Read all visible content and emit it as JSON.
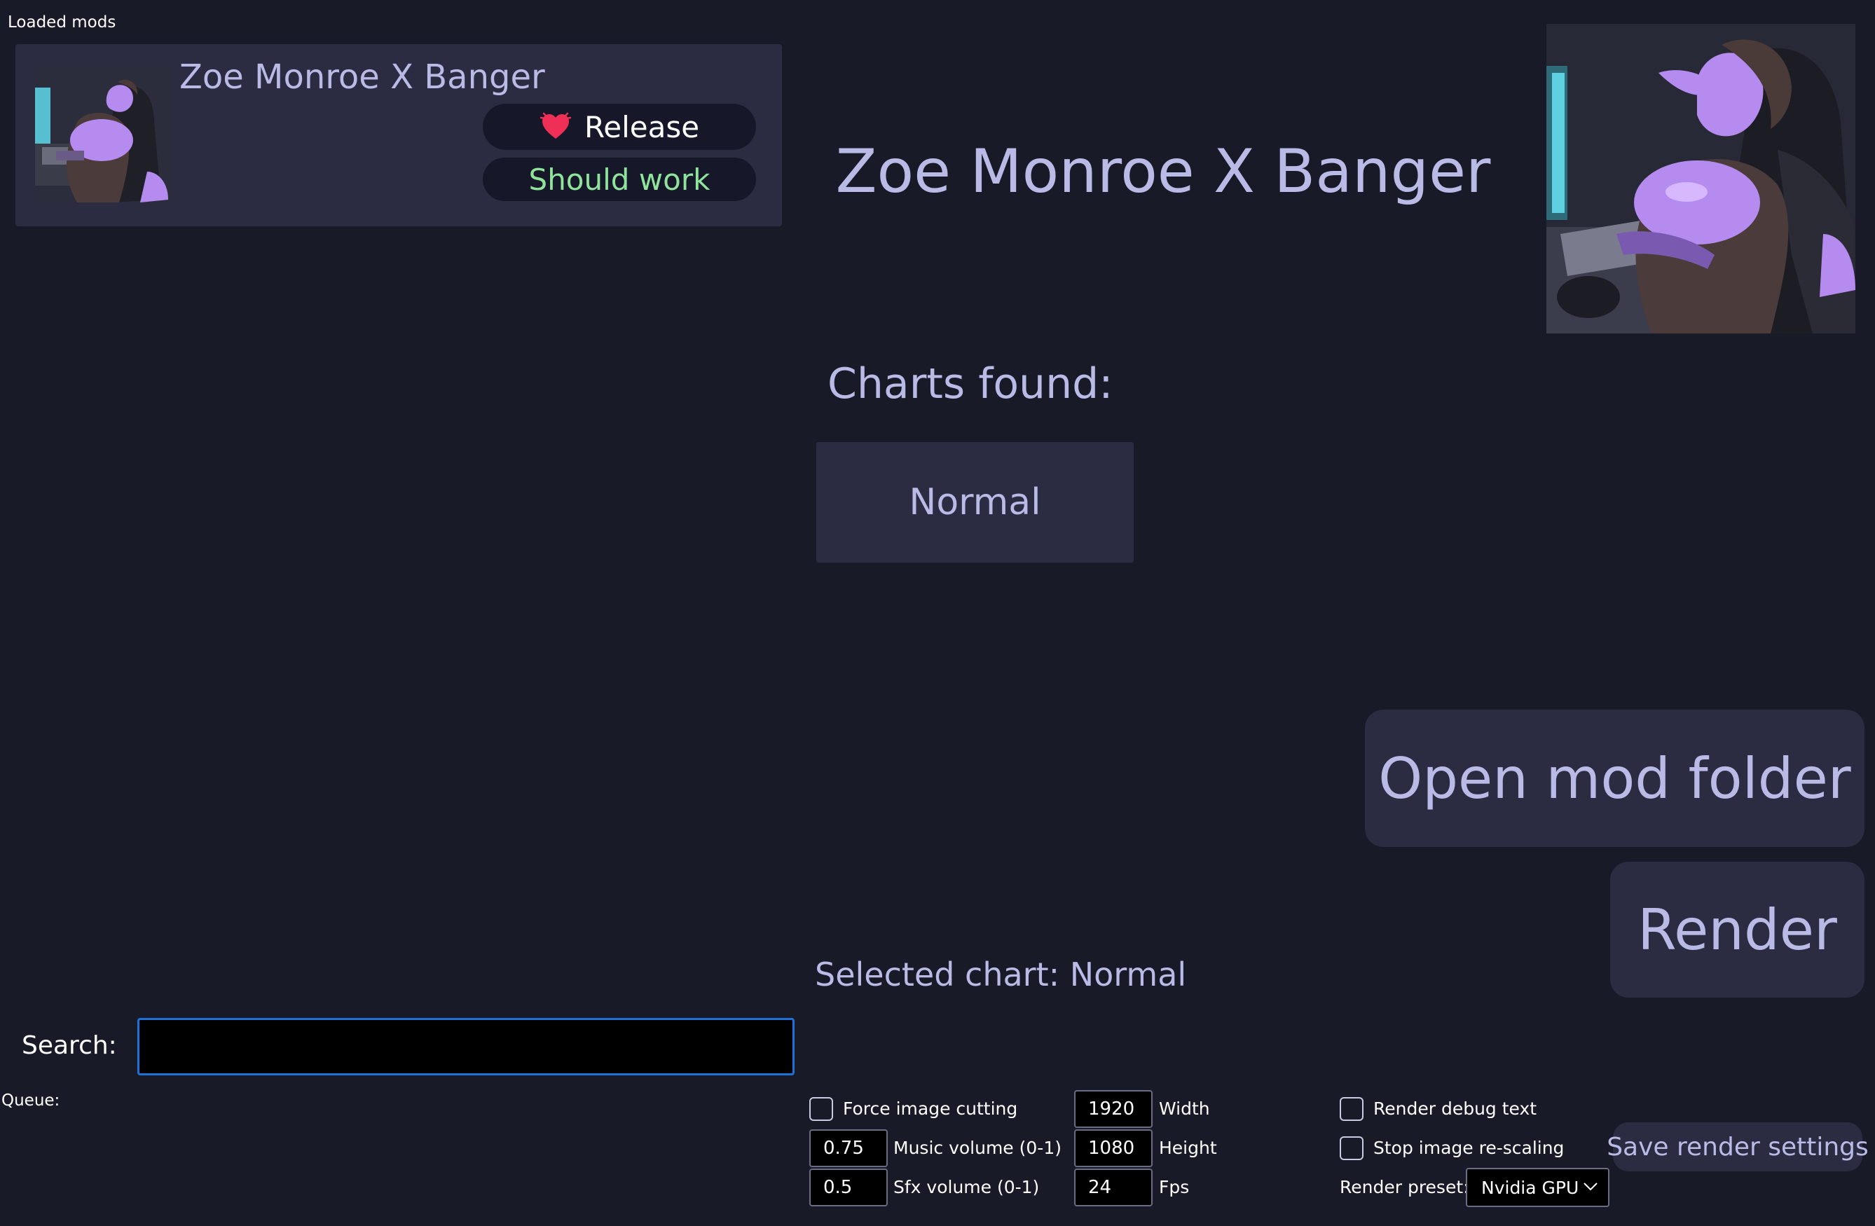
{
  "mods_panel": {
    "label": "Loaded mods",
    "mod": {
      "title": "Zoe Monroe X Banger",
      "status_label": "Release",
      "status_icon": "heart-icon",
      "compat_label": "Should work",
      "compat_color": "#8fe39a"
    }
  },
  "detail": {
    "title": "Zoe Monroe X Banger",
    "charts_found_label": "Charts found:",
    "charts": [
      "Normal"
    ],
    "open_folder_label": "Open mod folder",
    "render_label": "Render",
    "selected_chart_text": "Selected chart: Normal"
  },
  "search": {
    "label": "Search:",
    "value": ""
  },
  "queue": {
    "label": "Queue:"
  },
  "settings": {
    "force_image_cutting": {
      "label": "Force image cutting",
      "checked": false
    },
    "music_volume": {
      "label": "Music volume (0-1)",
      "value": "0.75"
    },
    "sfx_volume": {
      "label": "Sfx volume (0-1)",
      "value": "0.5"
    },
    "width": {
      "label": "Width",
      "value": "1920"
    },
    "height": {
      "label": "Height",
      "value": "1080"
    },
    "fps": {
      "label": "Fps",
      "value": "24"
    },
    "render_debug_text": {
      "label": "Render debug text",
      "checked": false
    },
    "stop_image_rescaling": {
      "label": "Stop image re-scaling",
      "checked": false
    },
    "render_preset": {
      "label": "Render preset:",
      "value": "Nvidia GPU"
    },
    "save_label": "Save render settings"
  },
  "colors": {
    "background": "#181a27",
    "panel": "#2b2c41",
    "text": "#b9bbe6",
    "accent_focus": "#1c72d9",
    "heart": "#ef2f55"
  }
}
